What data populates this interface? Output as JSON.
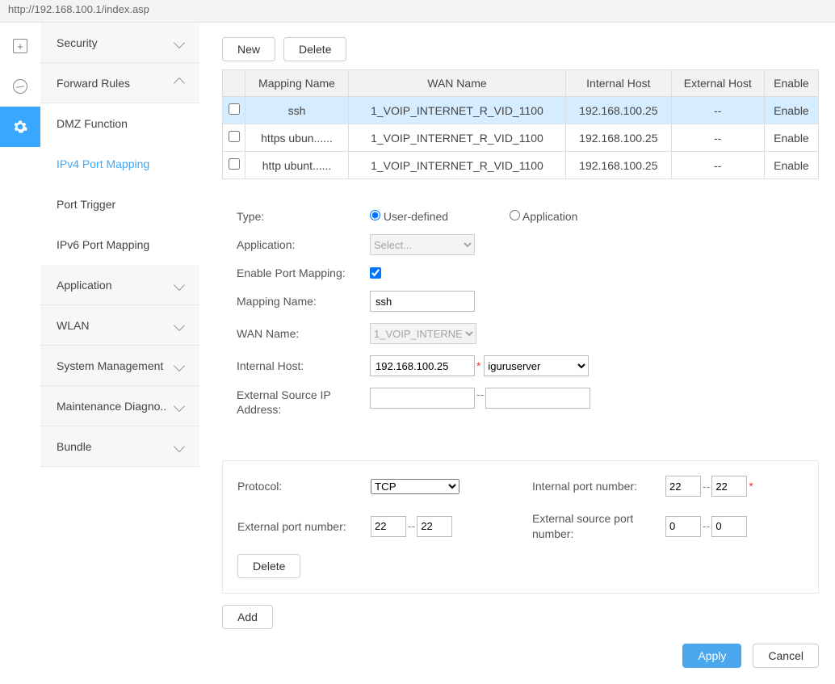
{
  "addr": "http://192.168.100.1/index.asp",
  "sidebar": {
    "sections": [
      {
        "label": "Security",
        "open": false
      },
      {
        "label": "Forward Rules",
        "open": true
      },
      {
        "label": "Application",
        "open": false
      },
      {
        "label": "WLAN",
        "open": false
      },
      {
        "label": "System Management",
        "open": false
      },
      {
        "label": "Maintenance Diagno..",
        "open": false
      },
      {
        "label": "Bundle",
        "open": false
      }
    ],
    "sub": [
      {
        "label": "DMZ Function"
      },
      {
        "label": "IPv4 Port Mapping",
        "active": true
      },
      {
        "label": "Port Trigger"
      },
      {
        "label": "IPv6 Port Mapping"
      }
    ]
  },
  "buttons": {
    "new": "New",
    "delete": "Delete",
    "add": "Add",
    "apply": "Apply",
    "cancel": "Cancel"
  },
  "table": {
    "headers": [
      "",
      "Mapping Name",
      "WAN Name",
      "Internal Host",
      "External Host",
      "Enable"
    ],
    "rows": [
      {
        "name": "ssh",
        "wan": "1_VOIP_INTERNET_R_VID_1100",
        "host": "192.168.100.25",
        "ext": "--",
        "enable": "Enable",
        "sel": true
      },
      {
        "name": "https ubun......",
        "wan": "1_VOIP_INTERNET_R_VID_1100",
        "host": "192.168.100.25",
        "ext": "--",
        "enable": "Enable",
        "sel": false
      },
      {
        "name": "http ubunt......",
        "wan": "1_VOIP_INTERNET_R_VID_1100",
        "host": "192.168.100.25",
        "ext": "--",
        "enable": "Enable",
        "sel": false
      }
    ]
  },
  "form": {
    "type_label": "Type:",
    "type_opt1": "User-defined",
    "type_opt2": "Application",
    "app_label": "Application:",
    "app_select": "Select...",
    "enable_label": "Enable Port Mapping:",
    "enable_checked": true,
    "mapname_label": "Mapping Name:",
    "mapname_value": "ssh",
    "wan_label": "WAN Name:",
    "wan_value": "1_VOIP_INTERNE",
    "ihost_label": "Internal Host:",
    "ihost_value": "192.168.100.25",
    "ihost_dev": "iguruserver",
    "extsrc_label": "External Source IP Address:"
  },
  "ports": {
    "proto_label": "Protocol:",
    "proto_value": "TCP",
    "iport_label": "Internal port number:",
    "iport_a": "22",
    "iport_b": "22",
    "eport_label": "External port number:",
    "eport_a": "22",
    "eport_b": "22",
    "esport_label": "External source port number:",
    "esport_a": "0",
    "esport_b": "0",
    "delete": "Delete"
  }
}
